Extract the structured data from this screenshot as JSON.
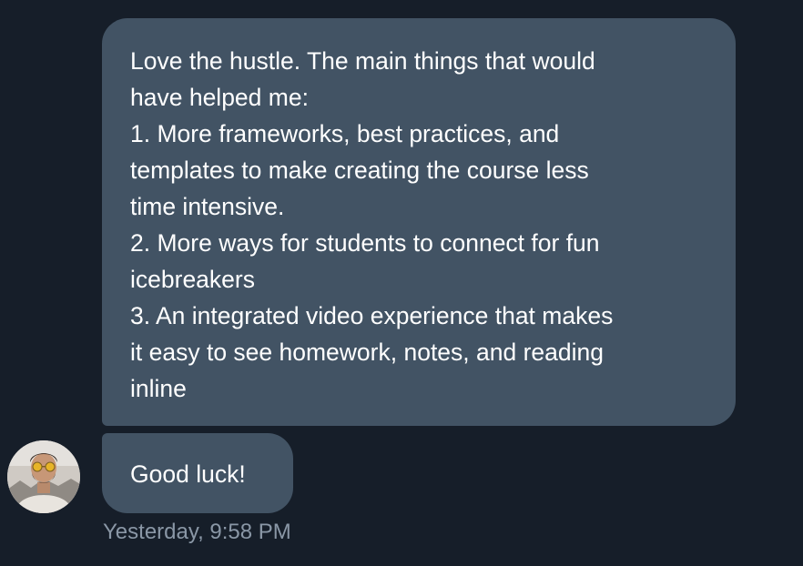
{
  "conversation": {
    "messages": [
      {
        "lines": [
          "Love the hustle. The main things that would",
          "have helped me:",
          "1. More frameworks, best practices, and",
          "templates to make creating the course less",
          "time intensive.",
          "2. More ways for students to connect for fun",
          "icebreakers",
          "3. An integrated video experience that makes",
          "it easy to see homework, notes, and reading",
          "inline"
        ]
      },
      {
        "text": "Good luck!"
      }
    ],
    "timestamp": "Yesterday, 9:58 PM",
    "avatar_icon": "user-avatar-photo"
  },
  "colors": {
    "background": "#161e29",
    "bubble": "#425364",
    "message_text": "#ffffff",
    "timestamp_text": "#8a97a6"
  }
}
